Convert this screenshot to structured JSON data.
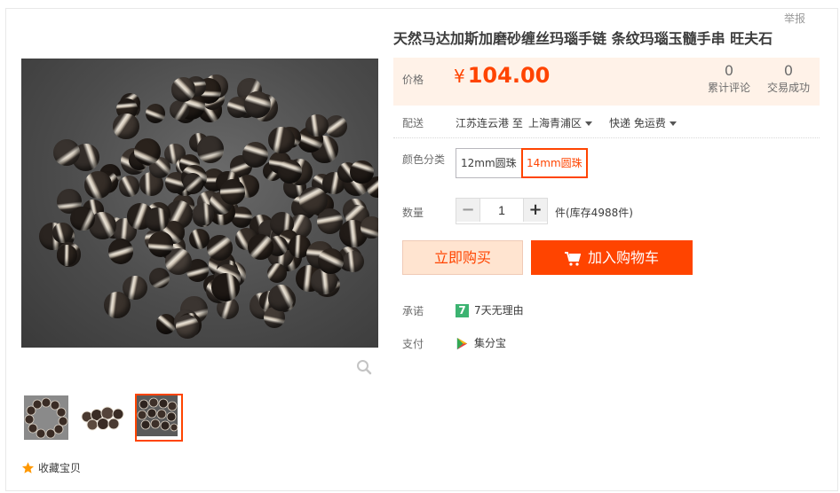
{
  "header": {
    "report_label": "举报"
  },
  "product": {
    "title": "天然马达加斯加磨砂缠丝玛瑙手链 条纹玛瑙玉髓手串 旺夫石",
    "price_label": "价格",
    "currency": "¥",
    "price": "104.00",
    "stats": [
      {
        "value": "0",
        "label": "累计评论"
      },
      {
        "value": "0",
        "label": "交易成功"
      }
    ]
  },
  "delivery": {
    "label": "配送",
    "from": "江苏连云港 至",
    "to": "上海青浦区",
    "method": "快递 免运费"
  },
  "sku": {
    "label": "颜色分类",
    "options": [
      "12mm圆珠",
      "14mm圆珠"
    ],
    "selected": "14mm圆珠"
  },
  "quantity": {
    "label": "数量",
    "value": "1",
    "minus": "−",
    "plus": "+",
    "stock_text": "件(库存4988件)"
  },
  "actions": {
    "buy_now": "立即购买",
    "add_to_cart": "加入购物车"
  },
  "promise": {
    "label": "承诺",
    "badge": "7",
    "text": "7天无理由"
  },
  "payment": {
    "label": "支付",
    "text": "集分宝"
  },
  "gallery": {
    "favorite": "收藏宝贝",
    "thumbnail_count": 3,
    "selected_thumbnail": 3
  },
  "colors": {
    "accent": "#ff4400",
    "price_bg": "#fff2e8",
    "buy_bg": "#ffe4d0"
  }
}
